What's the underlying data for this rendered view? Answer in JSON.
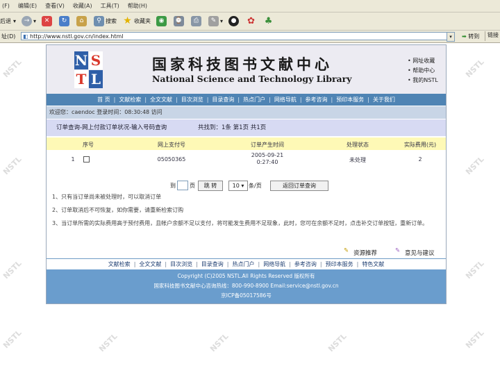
{
  "menu": [
    "(F)",
    "编辑(E)",
    "查看(V)",
    "收藏(A)",
    "工具(T)",
    "帮助(H)"
  ],
  "toolbar": {
    "back": "后退",
    "search": "搜索",
    "favorites": "收藏夹"
  },
  "address": {
    "label": "址(D)",
    "url": "http://www.nstl.gov.cn/index.html",
    "go": "转到",
    "links": "链接"
  },
  "site": {
    "watermark": "NSTL",
    "logo_letters": [
      "N",
      "S",
      "T",
      "L"
    ],
    "title_cn": "国家科技图书文献中心",
    "title_en": "National Science and Technology Library",
    "quick_links": [
      "• 网址收藏",
      "• 帮助中心",
      "• 我的NSTL"
    ]
  },
  "nav": [
    "首 页",
    "文献检索",
    "全文文献",
    "目次浏览",
    "目录查询",
    "热点门户",
    "网络导航",
    "参考咨询",
    "预印本服务",
    "关于我们"
  ],
  "welcome": "欢迎您：caendoc 登录时间：08:30:48 访问",
  "breadcrumb": {
    "path": "订单查询-网上付款订单状况-输入号码查询",
    "count": "共找到：1条  第1页  共1页"
  },
  "table": {
    "headers": [
      "序号",
      "网上支付号",
      "订单产生时间",
      "处理状态",
      "实际费用(元)"
    ],
    "rows": [
      {
        "no": "1",
        "pay_no": "05050365",
        "date": "2005-09-21",
        "time": "0:27:40",
        "status": "未处理",
        "fee": "2"
      }
    ]
  },
  "pager": {
    "goto": "到",
    "page_unit": "页",
    "go_btn": "跳 转",
    "per_page": "10",
    "per_page_unit": "条/页",
    "back_btn": "返回订单查询"
  },
  "notes": [
    "1、只有当订单尚未被处理时，可以取消订单",
    "2、订单取消后不可恢复，如你需要，请重新检索订购",
    "3、当订单所需的实际费用高于预付费用，且帐户余额不足以支付，将可能发生费用不足现象，此时，您可在余额不足时，点击补交订单按钮，重新订单。"
  ],
  "feedback": {
    "recommend": "资源推荐",
    "suggest": "意见与建议"
  },
  "footer_nav": [
    "文献检索",
    "全文文献",
    "目次浏览",
    "目录查询",
    "热点门户",
    "网络导航",
    "参考咨询",
    "预印本服务",
    "特色文献"
  ],
  "footer": {
    "copyright": "Copyright (C)2005 NSTL.All Rights Reserved 版权所有",
    "contact": "国家科技图书文献中心咨询热线：800-990-8900 Email:service@nstl.gov.cn",
    "icp": "京ICP备05017586号"
  },
  "colors": {
    "nav_bg": "#4f84b4",
    "footer_bg": "#6a9dcd",
    "header_bg": "#fef9b6",
    "logo_red": "#d9382c",
    "logo_blue": "#2f5fa8"
  }
}
